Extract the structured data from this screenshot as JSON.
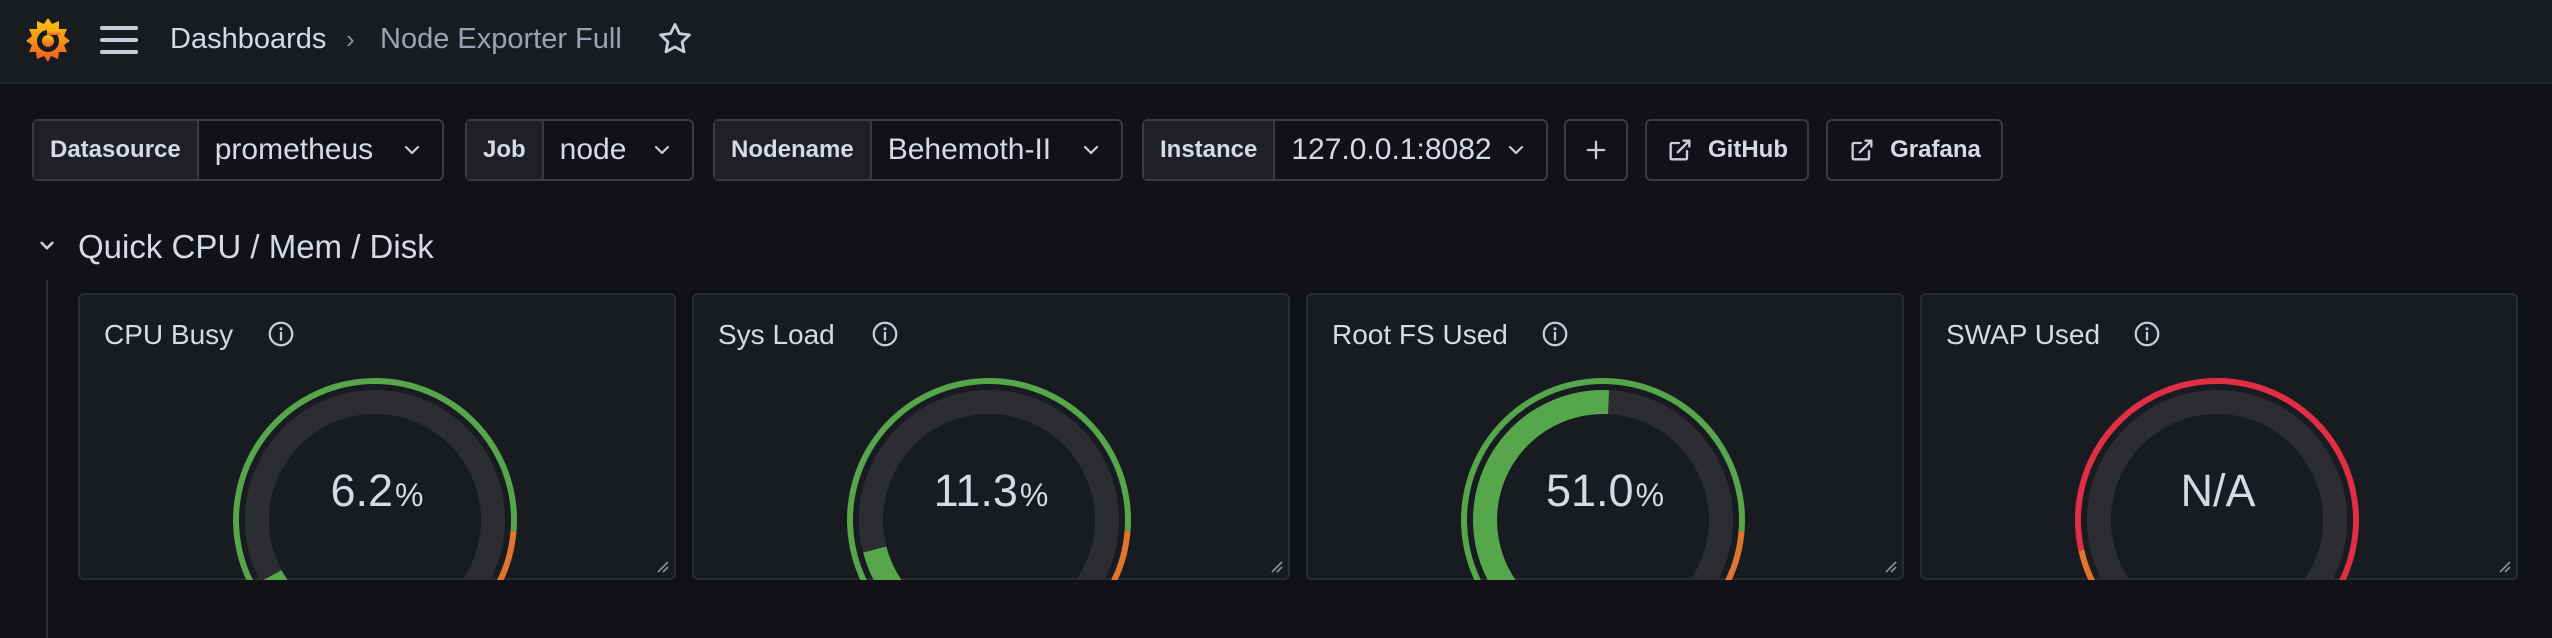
{
  "breadcrumb": {
    "parent": "Dashboards",
    "separator": "›",
    "current": "Node Exporter Full"
  },
  "variables": [
    {
      "label": "Datasource",
      "value": "prometheus"
    },
    {
      "label": "Job",
      "value": "node"
    },
    {
      "label": "Nodename",
      "value": "Behemoth-II"
    },
    {
      "label": "Instance",
      "value": "127.0.0.1:8082"
    }
  ],
  "links": {
    "github": "GitHub",
    "grafana": "Grafana"
  },
  "row": {
    "title": "Quick CPU / Mem / Disk"
  },
  "panels": [
    {
      "title": "CPU Busy",
      "value": "6.2",
      "unit": "%",
      "fraction": 0.062
    },
    {
      "title": "Sys Load",
      "value": "11.3",
      "unit": "%",
      "fraction": 0.113
    },
    {
      "title": "Root FS Used",
      "value": "51.0",
      "unit": "%",
      "fraction": 0.51
    },
    {
      "title": "SWAP Used",
      "value": "N/A",
      "unit": "",
      "fraction": 0
    }
  ],
  "colors": {
    "background": "#111217",
    "panel": "#181b1f",
    "green": "#56a64b",
    "orange": "#e0752d",
    "red": "#e02f44",
    "track": "#2c2d33",
    "logo": "#f46800"
  },
  "icons": [
    "grafana-logo-icon",
    "menu-icon",
    "star-icon",
    "chevron-down-icon",
    "plus-icon",
    "external-link-icon",
    "info-icon",
    "resize-handle-icon"
  ]
}
